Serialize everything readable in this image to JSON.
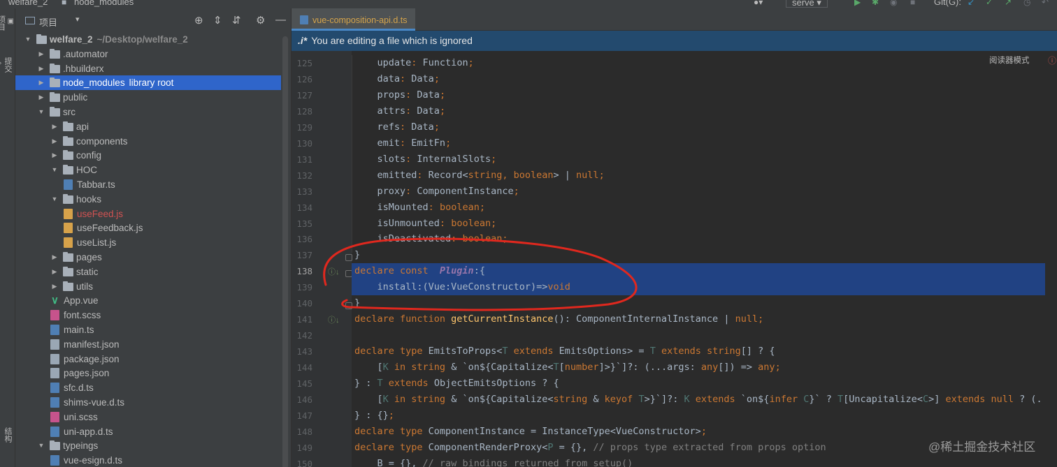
{
  "topbar": {
    "project_crumb": "welfare_2",
    "folder_crumb": "node_modules",
    "run_config": "serve",
    "git_label": "Git(G):"
  },
  "left_strip": {
    "project_tab": "项目",
    "commit_tab": "提交",
    "structure_tab": "结构"
  },
  "project_panel": {
    "title": "项目",
    "tree": [
      {
        "label": "welfare_2",
        "hint": "~/Desktop/welfare_2",
        "depth": 0,
        "kind": "folder",
        "expanded": true
      },
      {
        "label": ".automator",
        "depth": 1,
        "kind": "folder",
        "expanded": false
      },
      {
        "label": ".hbuilderx",
        "depth": 1,
        "kind": "folder",
        "expanded": false
      },
      {
        "label": "node_modules",
        "hint": "library root",
        "depth": 1,
        "kind": "folder",
        "expanded": false,
        "selected": true
      },
      {
        "label": "public",
        "depth": 1,
        "kind": "folder",
        "expanded": false
      },
      {
        "label": "src",
        "depth": 1,
        "kind": "folder",
        "expanded": true
      },
      {
        "label": "api",
        "depth": 2,
        "kind": "folder",
        "expanded": false
      },
      {
        "label": "components",
        "depth": 2,
        "kind": "folder",
        "expanded": false
      },
      {
        "label": "config",
        "depth": 2,
        "kind": "folder",
        "expanded": false
      },
      {
        "label": "HOC",
        "depth": 2,
        "kind": "folder",
        "expanded": true
      },
      {
        "label": "Tabbar.ts",
        "depth": 3,
        "kind": "ts"
      },
      {
        "label": "hooks",
        "depth": 2,
        "kind": "folder",
        "expanded": true
      },
      {
        "label": "useFeed.js",
        "depth": 3,
        "kind": "js",
        "modified": true
      },
      {
        "label": "useFeedback.js",
        "depth": 3,
        "kind": "js"
      },
      {
        "label": "useList.js",
        "depth": 3,
        "kind": "js"
      },
      {
        "label": "pages",
        "depth": 2,
        "kind": "folder",
        "expanded": false
      },
      {
        "label": "static",
        "depth": 2,
        "kind": "folder",
        "expanded": false
      },
      {
        "label": "utils",
        "depth": 2,
        "kind": "folder",
        "expanded": false
      },
      {
        "label": "App.vue",
        "depth": 2,
        "kind": "vue"
      },
      {
        "label": "font.scss",
        "depth": 2,
        "kind": "sass"
      },
      {
        "label": "main.ts",
        "depth": 2,
        "kind": "ts"
      },
      {
        "label": "manifest.json",
        "depth": 2,
        "kind": "json"
      },
      {
        "label": "package.json",
        "depth": 2,
        "kind": "json"
      },
      {
        "label": "pages.json",
        "depth": 2,
        "kind": "json"
      },
      {
        "label": "sfc.d.ts",
        "depth": 2,
        "kind": "ts"
      },
      {
        "label": "shims-vue.d.ts",
        "depth": 2,
        "kind": "ts"
      },
      {
        "label": "uni.scss",
        "depth": 2,
        "kind": "sass"
      },
      {
        "label": "uni-app.d.ts",
        "depth": 2,
        "kind": "ts"
      },
      {
        "label": "typeings",
        "depth": 1,
        "kind": "folder",
        "expanded": true
      },
      {
        "label": "vue-esign.d.ts",
        "depth": 2,
        "kind": "ts"
      }
    ]
  },
  "editor": {
    "tab_label": "vue-composition-api.d.ts",
    "banner_icon": ".i*",
    "banner_text": "You are editing a file which is ignored",
    "reader_mode": "阅读器模式",
    "current_line": 138,
    "lines": [
      {
        "n": 125,
        "code": [
          [
            "ty",
            "    update"
          ],
          [
            "pu",
            ": "
          ],
          [
            "ty",
            "Function"
          ],
          [
            "pu",
            ";"
          ]
        ]
      },
      {
        "n": 126,
        "code": [
          [
            "ty",
            "    data"
          ],
          [
            "pu",
            ": "
          ],
          [
            "ty",
            "Data"
          ],
          [
            "pu",
            ";"
          ]
        ]
      },
      {
        "n": 127,
        "code": [
          [
            "ty",
            "    props"
          ],
          [
            "pu",
            ": "
          ],
          [
            "ty",
            "Data"
          ],
          [
            "pu",
            ";"
          ]
        ]
      },
      {
        "n": 128,
        "code": [
          [
            "ty",
            "    attrs"
          ],
          [
            "pu",
            ": "
          ],
          [
            "ty",
            "Data"
          ],
          [
            "pu",
            ";"
          ]
        ]
      },
      {
        "n": 129,
        "code": [
          [
            "ty",
            "    refs"
          ],
          [
            "pu",
            ": "
          ],
          [
            "ty",
            "Data"
          ],
          [
            "pu",
            ";"
          ]
        ]
      },
      {
        "n": 130,
        "code": [
          [
            "ty",
            "    emit"
          ],
          [
            "pu",
            ": "
          ],
          [
            "ty",
            "EmitFn"
          ],
          [
            "pu",
            ";"
          ]
        ]
      },
      {
        "n": 131,
        "code": [
          [
            "ty",
            "    slots"
          ],
          [
            "pu",
            ": "
          ],
          [
            "ty",
            "InternalSlots"
          ],
          [
            "pu",
            ";"
          ]
        ]
      },
      {
        "n": 132,
        "code": [
          [
            "ty",
            "    emitted"
          ],
          [
            "pu",
            ": "
          ],
          [
            "ty",
            "Record<"
          ],
          [
            "kw",
            "string"
          ],
          [
            "pu",
            ", "
          ],
          [
            "kw",
            "boolean"
          ],
          [
            "ty",
            "> | "
          ],
          [
            "kw",
            "null"
          ],
          [
            "pu",
            ";"
          ]
        ]
      },
      {
        "n": 133,
        "code": [
          [
            "ty",
            "    proxy"
          ],
          [
            "pu",
            ": "
          ],
          [
            "ty",
            "ComponentInstance"
          ],
          [
            "pu",
            ";"
          ]
        ]
      },
      {
        "n": 134,
        "code": [
          [
            "ty",
            "    isMounted"
          ],
          [
            "pu",
            ": "
          ],
          [
            "kw",
            "boolean"
          ],
          [
            "pu",
            ";"
          ]
        ]
      },
      {
        "n": 135,
        "code": [
          [
            "ty",
            "    isUnmounted"
          ],
          [
            "pu",
            ": "
          ],
          [
            "kw",
            "boolean"
          ],
          [
            "pu",
            ";"
          ]
        ]
      },
      {
        "n": 136,
        "code": [
          [
            "ty",
            "    isDeactivated"
          ],
          [
            "pu",
            ": "
          ],
          [
            "kw",
            "boolean"
          ],
          [
            "pu",
            ";"
          ]
        ]
      },
      {
        "n": 137,
        "code": [
          [
            "ty",
            "}"
          ]
        ]
      },
      {
        "n": 138,
        "code": [
          [
            "kw",
            "declare const  "
          ],
          [
            "pl",
            "Plugin"
          ],
          [
            "ty",
            ":{"
          ]
        ]
      },
      {
        "n": 139,
        "code": [
          [
            "ty",
            "    install:(Vue:VueConstructor)=>"
          ],
          [
            "kw",
            "void"
          ]
        ]
      },
      {
        "n": 140,
        "code": [
          [
            "ty",
            "}"
          ]
        ]
      },
      {
        "n": 141,
        "code": [
          [
            "kw",
            "declare function "
          ],
          [
            "fn",
            "getCurrentInstance"
          ],
          [
            "ty",
            "(): ComponentInternalInstance | "
          ],
          [
            "kw",
            "null"
          ],
          [
            "pu",
            ";"
          ]
        ]
      },
      {
        "n": 142,
        "code": []
      },
      {
        "n": 143,
        "code": [
          [
            "kw",
            "declare type "
          ],
          [
            "ty",
            "EmitsToProps<"
          ],
          [
            "tp",
            "T "
          ],
          [
            "kw",
            "extends "
          ],
          [
            "ty",
            "EmitsOptions> = "
          ],
          [
            "tp",
            "T "
          ],
          [
            "kw",
            "extends string"
          ],
          [
            "ty",
            "[] ? {"
          ]
        ]
      },
      {
        "n": 144,
        "code": [
          [
            "ty",
            "    ["
          ],
          [
            "tp",
            "K "
          ],
          [
            "kw",
            "in string "
          ],
          [
            "ty",
            "& `"
          ],
          [
            "ty",
            "on${Capitalize<"
          ],
          [
            "tp",
            "T"
          ],
          [
            "ty",
            "["
          ],
          [
            "kw",
            "number"
          ],
          [
            "ty",
            "]>}`]?: (...args: "
          ],
          [
            "kw",
            "any"
          ],
          [
            "ty",
            "[]) => "
          ],
          [
            "kw",
            "any"
          ],
          [
            "pu",
            ";"
          ]
        ]
      },
      {
        "n": 145,
        "code": [
          [
            "ty",
            "} : "
          ],
          [
            "tp",
            "T "
          ],
          [
            "kw",
            "extends "
          ],
          [
            "ty",
            "ObjectEmitsOptions ? {"
          ]
        ]
      },
      {
        "n": 146,
        "code": [
          [
            "ty",
            "    ["
          ],
          [
            "tp",
            "K "
          ],
          [
            "kw",
            "in string "
          ],
          [
            "ty",
            "& `"
          ],
          [
            "ty",
            "on${Capitalize<"
          ],
          [
            "kw",
            "string "
          ],
          [
            "ty",
            "& "
          ],
          [
            "kw",
            "keyof "
          ],
          [
            "tp",
            "T"
          ],
          [
            "ty",
            ">}`]?: "
          ],
          [
            "tp",
            "K "
          ],
          [
            "kw",
            "extends "
          ],
          [
            "ty",
            "`on${"
          ],
          [
            "kw",
            "infer "
          ],
          [
            "tp",
            "C"
          ],
          [
            "ty",
            "}` ? "
          ],
          [
            "tp",
            "T"
          ],
          [
            "ty",
            "[Uncapitalize<"
          ],
          [
            "tp",
            "C"
          ],
          [
            "ty",
            ">] "
          ],
          [
            "kw",
            "extends null "
          ],
          [
            "ty",
            "? (...a"
          ]
        ]
      },
      {
        "n": 147,
        "code": [
          [
            "ty",
            "} : {}"
          ],
          [
            "pu",
            ";"
          ]
        ]
      },
      {
        "n": 148,
        "code": [
          [
            "kw",
            "declare type "
          ],
          [
            "ty",
            "ComponentInstance = InstanceType<VueConstructor>"
          ],
          [
            "pu",
            ";"
          ]
        ]
      },
      {
        "n": 149,
        "code": [
          [
            "kw",
            "declare type "
          ],
          [
            "ty",
            "ComponentRenderProxy<"
          ],
          [
            "tp",
            "P "
          ],
          [
            "ty",
            "= {}, "
          ],
          [
            "cm",
            "// props type extracted from props option"
          ]
        ]
      },
      {
        "n": 150,
        "code": [
          [
            "ty",
            "    B = {}, "
          ],
          [
            "cm",
            "// raw bindings returned from setup()"
          ]
        ]
      }
    ]
  },
  "watermark": "@稀土掘金技术社区",
  "colors": {
    "selection": "#214283",
    "tree_selection": "#2f65ca",
    "banner": "#234a6e",
    "annotation": "#e0281e",
    "keyword": "#cc7832"
  }
}
